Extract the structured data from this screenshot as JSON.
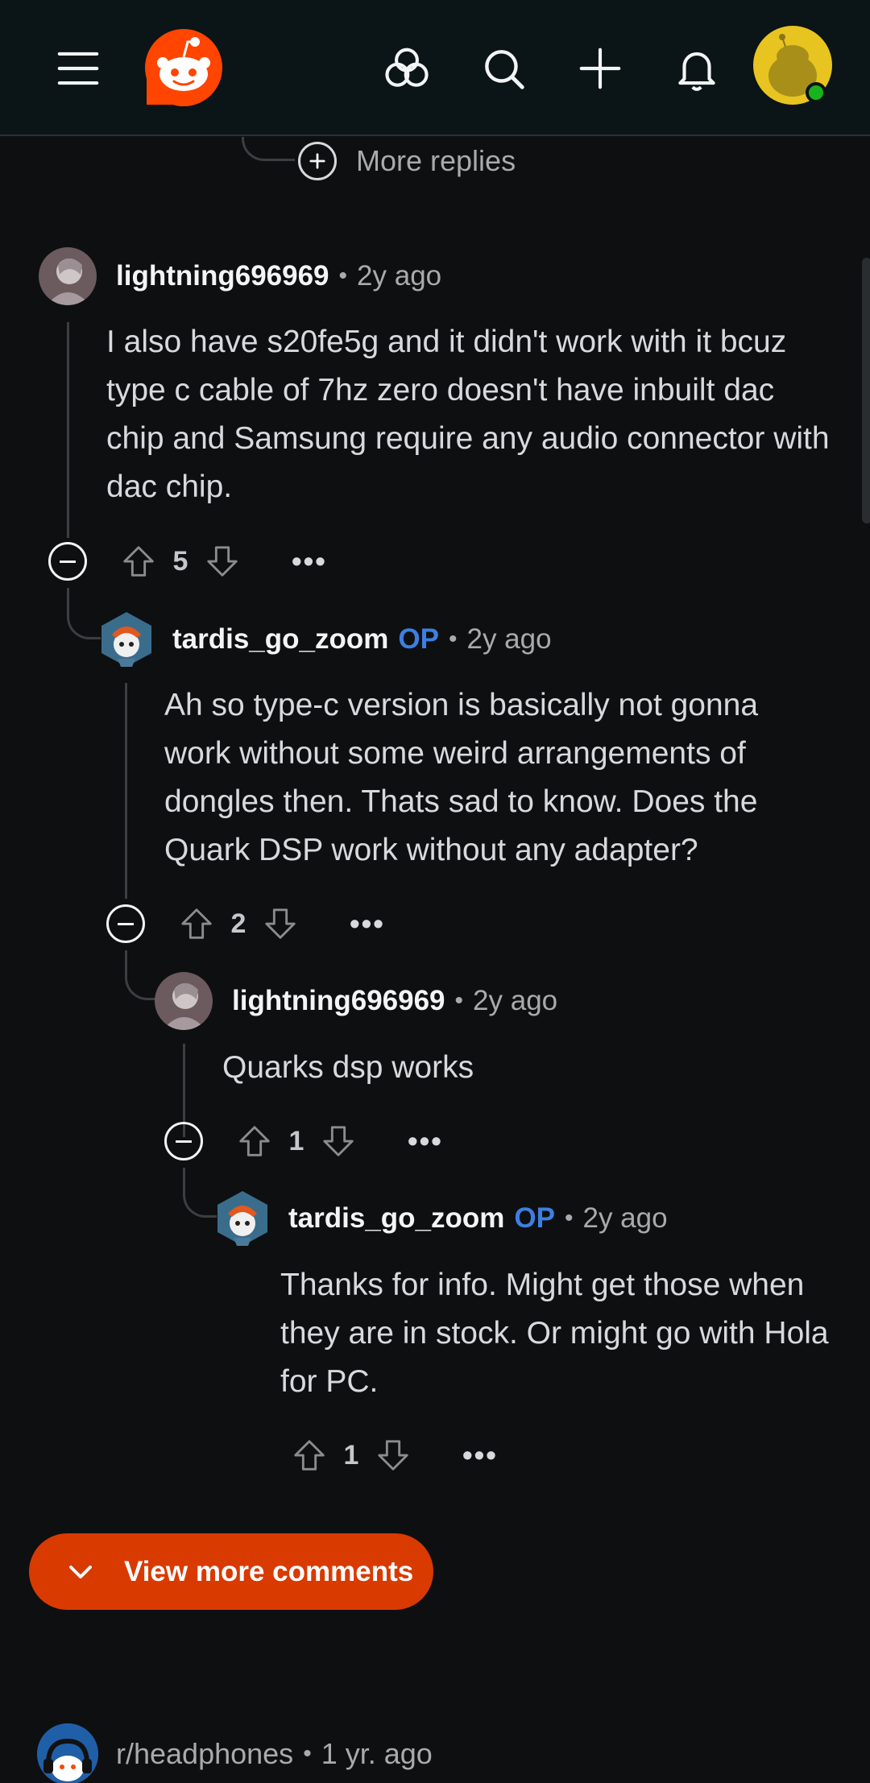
{
  "colors": {
    "accent": "#d93a00",
    "op": "#3d7fe0",
    "background": "#0e0f11"
  },
  "header": {
    "icons": [
      "menu-icon",
      "reddit-logo",
      "communities-icon",
      "search-icon",
      "plus-icon",
      "bell-icon",
      "user-avatar"
    ]
  },
  "more_replies_label": "More replies",
  "comments": [
    {
      "user": "lightning696969",
      "op": "",
      "sep": "•",
      "time": "2y ago",
      "text": "I also have s20fe5g and it didn't work with it bcuz type c cable of 7hz zero doesn't have inbuilt dac chip and Samsung require any audio connector with dac chip.",
      "score": "5",
      "menu": "•••"
    },
    {
      "user": "tardis_go_zoom",
      "op": "OP",
      "sep": "•",
      "time": "2y ago",
      "text": "Ah so type-c version is basically not gonna work without some weird arrangements of dongles then. Thats sad to know. Does the Quark DSP work without any adapter?",
      "score": "2",
      "menu": "•••"
    },
    {
      "user": "lightning696969",
      "op": "",
      "sep": "•",
      "time": "2y ago",
      "text": "Quarks dsp works",
      "score": "1",
      "menu": "•••"
    },
    {
      "user": "tardis_go_zoom",
      "op": "OP",
      "sep": "•",
      "time": "2y ago",
      "text": "Thanks for info. Might get those when they are in stock. Or might go with Hola for PC.",
      "score": "1",
      "menu": "•••"
    }
  ],
  "view_more_label": "View more comments",
  "next_post": {
    "subreddit": "r/headphones",
    "sep": "•",
    "time": "1 yr. ago"
  }
}
